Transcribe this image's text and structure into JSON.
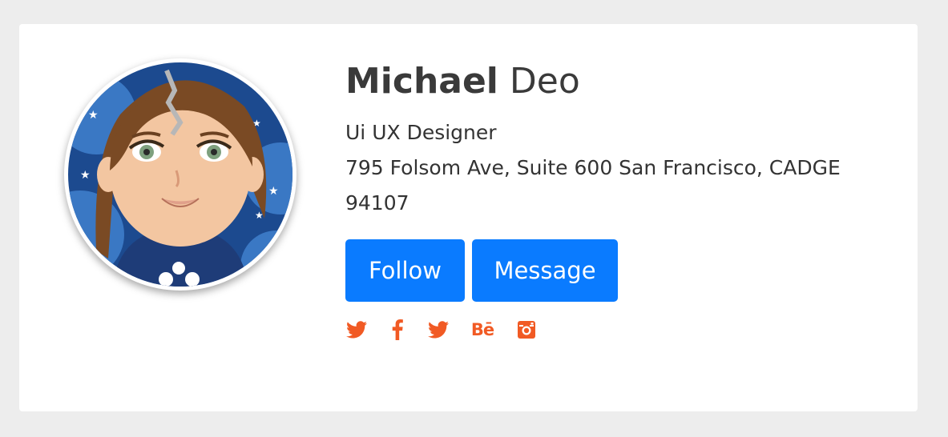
{
  "profile": {
    "first_name": "Michael",
    "last_name": "Deo",
    "title": "Ui UX Designer",
    "address": "795 Folsom Ave, Suite 600 San Francisco, CADGE 94107"
  },
  "actions": {
    "follow_label": "Follow",
    "message_label": "Message"
  },
  "social": {
    "icons": [
      "twitter-icon",
      "facebook-icon",
      "twitter-icon",
      "behance-icon",
      "instagram-icon"
    ],
    "behance_text": "Bē"
  },
  "colors": {
    "accent": "#0a7bff",
    "social": "#f15a24",
    "background": "#ededed",
    "card": "#ffffff"
  }
}
